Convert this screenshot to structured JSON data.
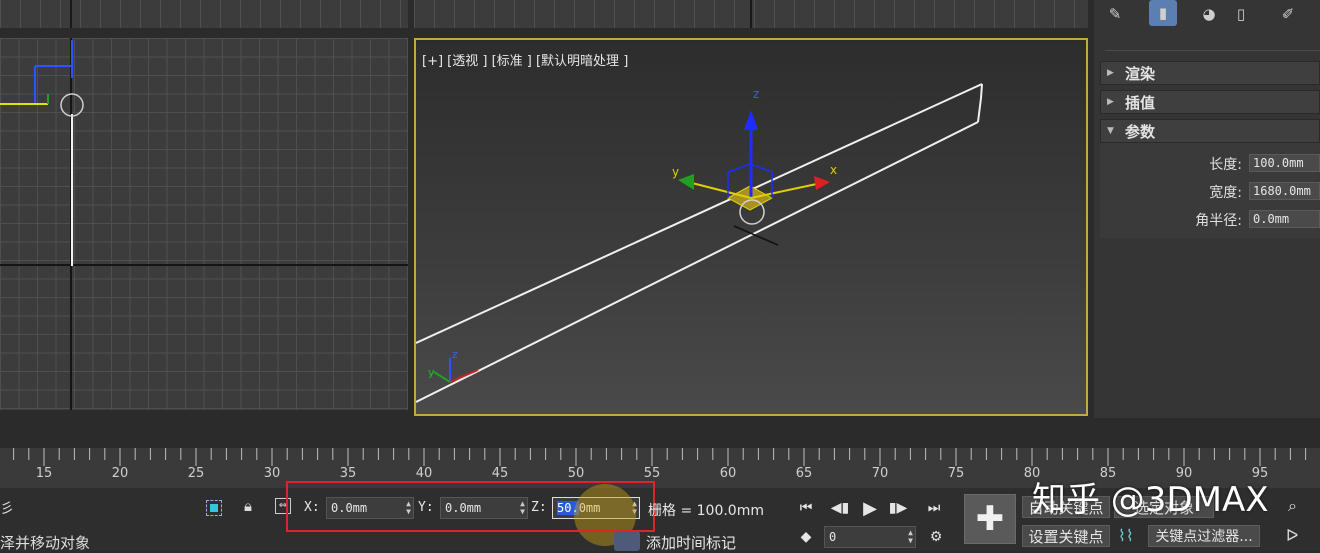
{
  "viewports": {
    "perspective_label": "[+] [透视 ] [标准 ] [默认明暗处理 ]",
    "gizmo_axes": {
      "x": "x",
      "y": "y",
      "z": "z"
    },
    "corner_axes": {
      "y": "y",
      "z": "z"
    }
  },
  "command_panel": {
    "toolbar_icons": [
      "pin-icon",
      "modify-icon",
      "hierarchy-icon",
      "trash-icon",
      "configure-icon"
    ],
    "rollouts": [
      {
        "label": "渲染",
        "expanded": false
      },
      {
        "label": "插值",
        "expanded": false
      },
      {
        "label": "参数",
        "expanded": true
      }
    ],
    "params": [
      {
        "label": "长度:",
        "value": "100.0mm"
      },
      {
        "label": "宽度:",
        "value": "1680.0mm"
      },
      {
        "label": "角半径:",
        "value": "0.0mm"
      }
    ]
  },
  "timeline": {
    "ticks": [
      "15",
      "20",
      "25",
      "30",
      "35",
      "40",
      "45",
      "50",
      "55",
      "60",
      "65",
      "70",
      "75",
      "80",
      "85",
      "90",
      "95"
    ]
  },
  "status_bar": {
    "prompt_top": "彡",
    "prompt_bottom": "泽并移动对象",
    "x_label": "X:",
    "x_value": "0.0mm",
    "y_label": "Y:",
    "y_value": "0.0mm",
    "z_label": "Z:",
    "z_value": "50.0mm",
    "z_highlight": "50.",
    "z_rest": "0mm",
    "grid_text": "栅格 = 100.0mm",
    "add_time_tag": "添加时间标记",
    "frame_value": "0",
    "auto_key": "自动关键点",
    "selected_object": "选定对象",
    "set_key": "设置关键点",
    "key_filters": "关键点过滤器...",
    "watermark": "知乎 @3DMAX",
    "accent_color": "#c8a548",
    "highlight_box_color": "#d9262b"
  }
}
